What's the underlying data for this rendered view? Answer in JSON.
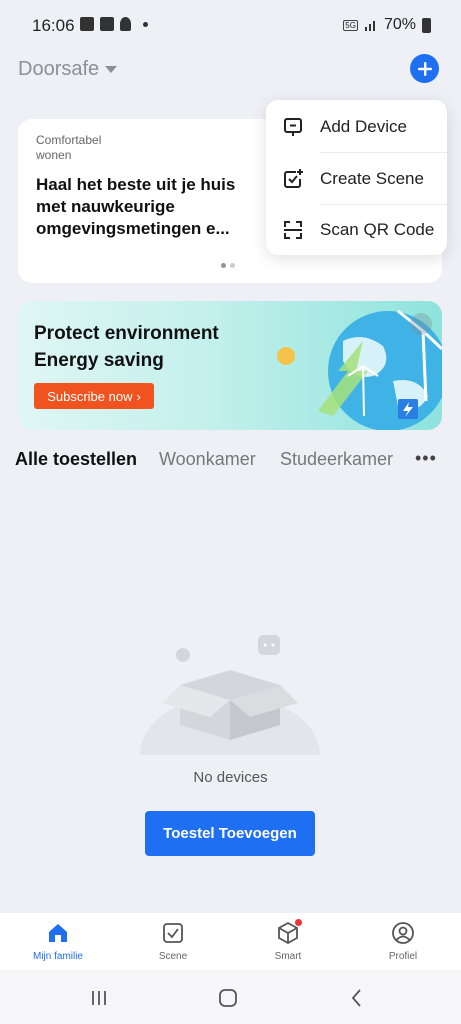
{
  "status_bar": {
    "time": "16:06",
    "network": "5G",
    "battery": "70%"
  },
  "header": {
    "home_name": "Doorsafe"
  },
  "info_card": {
    "subtitle": "Comfortabel wonen",
    "title": "Haal het beste uit je huis met nauwkeurige omgevingsmetingen e..."
  },
  "popup_menu": {
    "items": [
      {
        "label": "Add Device",
        "icon": "add-device-icon"
      },
      {
        "label": "Create Scene",
        "icon": "create-scene-icon"
      },
      {
        "label": "Scan QR Code",
        "icon": "scan-qr-icon"
      }
    ]
  },
  "banner": {
    "line1": "Protect environment",
    "line2": "Energy saving",
    "button_label": "Subscribe now"
  },
  "tabs": {
    "items": [
      "Alle toestellen",
      "Woonkamer",
      "Studeerkamer"
    ],
    "active_index": 0,
    "more": "•••"
  },
  "empty_state": {
    "text": "No devices",
    "button_label": "Toestel Toevoegen"
  },
  "bottom_nav": {
    "items": [
      {
        "label": "Mijn familie",
        "icon": "home-icon"
      },
      {
        "label": "Scene",
        "icon": "scene-icon"
      },
      {
        "label": "Smart",
        "icon": "smart-icon"
      },
      {
        "label": "Profiel",
        "icon": "profile-icon"
      }
    ],
    "active_index": 0
  },
  "colors": {
    "accent": "#1f6ff2",
    "banner_button": "#f0531f",
    "notification_dot": "#ee3333"
  }
}
